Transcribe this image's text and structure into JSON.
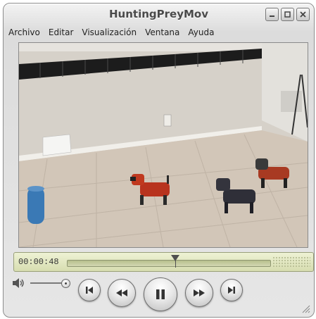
{
  "window": {
    "title": "HuntingPreyMov"
  },
  "menu": {
    "items": [
      "Archivo",
      "Editar",
      "Visualización",
      "Ventana",
      "Ayuda"
    ]
  },
  "player": {
    "timecode": "00:00:48",
    "position_fraction": 0.53,
    "volume_fraction": 1.0,
    "state": "playing"
  },
  "colors": {
    "scrubber_bg": "#e2e7c2",
    "chrome": "#dcdcdc"
  },
  "icons": {
    "volume": "speaker-icon",
    "skip_back": "skip-to-start-icon",
    "rewind": "rewind-icon",
    "pause": "pause-icon",
    "fast_forward": "fast-forward-icon",
    "skip_end": "skip-to-end-icon"
  }
}
